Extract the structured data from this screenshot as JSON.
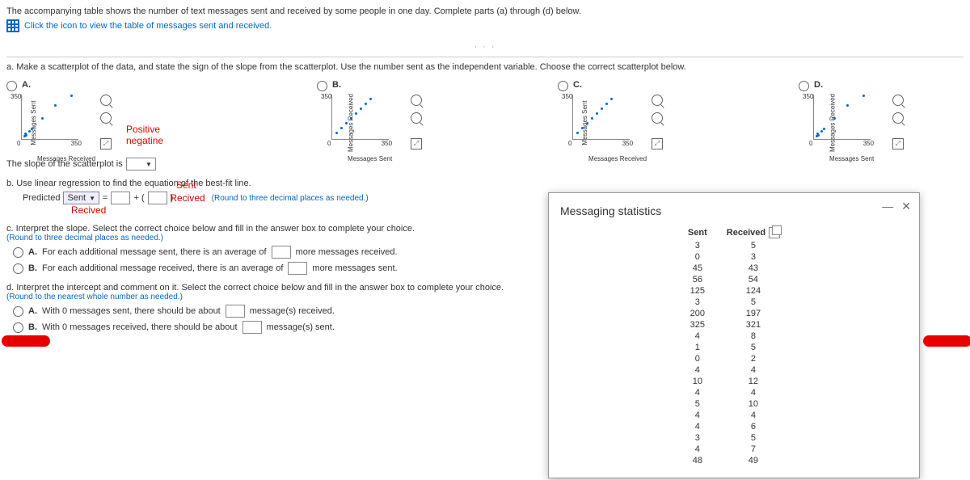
{
  "intro": "The accompanying table shows the number of text messages sent and received by some people in one day. Complete parts (a) through (d) below.",
  "view_link": "Click the icon to view the table of messages sent and received.",
  "dots": "· · ·",
  "part_a": "a. Make a scatterplot of the data, and state the sign of the slope from the scatterplot. Use the number sent as the independent variable. Choose the correct scatterplot below.",
  "options": {
    "A": "A.",
    "B": "B.",
    "C": "C.",
    "D": "D."
  },
  "axes": {
    "sent": "Messages Sent",
    "recv": "Messages Received",
    "ymax": "350",
    "zero": "0",
    "xmax": "350"
  },
  "anno_positive": "Positive",
  "anno_negative": "negatine",
  "slope_prefix": "The slope of the scatterplot is",
  "part_b": "b. Use linear regression to find the equation of the best-fit line.",
  "predicted": "Predicted",
  "dd_sent": "Sent",
  "eq_equals": "=",
  "eq_plus": "+ (",
  "eq_close": ")",
  "anno_sent": "Sent",
  "anno_recv": "Recived",
  "round3": "(Round to three decimal places as needed.)",
  "part_c": "c. Interpret the slope. Select the correct choice below and fill in the answer box to complete your choice.",
  "round3b": "(Round to three decimal places as needed.)",
  "cA_pre": "For each additional message sent, there is an average of",
  "cA_post": "more messages received.",
  "cB_pre": "For each additional message received, there is an average of",
  "cB_post": "more messages sent.",
  "part_d": "d. Interpret the intercept and comment on it. Select the correct choice below and fill in the answer box to complete your choice.",
  "round_whole": "(Round to the nearest whole number as needed.)",
  "dA_pre": "With 0 messages sent, there should be about",
  "dA_post": "message(s) received.",
  "dB_pre": "With 0 messages received, there should be about",
  "dB_post": "message(s) sent.",
  "labelA": "A.",
  "labelB": "B.",
  "modal_title": "Messaging statistics",
  "col_sent": "Sent",
  "col_recv": "Received",
  "chart_data": {
    "type": "table",
    "columns": [
      "Sent",
      "Received"
    ],
    "rows": [
      [
        3,
        5
      ],
      [
        0,
        3
      ],
      [
        45,
        43
      ],
      [
        56,
        54
      ],
      [
        125,
        124
      ],
      [
        3,
        5
      ],
      [
        200,
        197
      ],
      [
        325,
        321
      ],
      [
        4,
        8
      ],
      [
        1,
        5
      ],
      [
        0,
        2
      ],
      [
        4,
        4
      ],
      [
        10,
        12
      ],
      [
        4,
        4
      ],
      [
        5,
        10
      ],
      [
        4,
        4
      ],
      [
        4,
        6
      ],
      [
        3,
        5
      ],
      [
        4,
        7
      ],
      [
        48,
        49
      ]
    ]
  }
}
